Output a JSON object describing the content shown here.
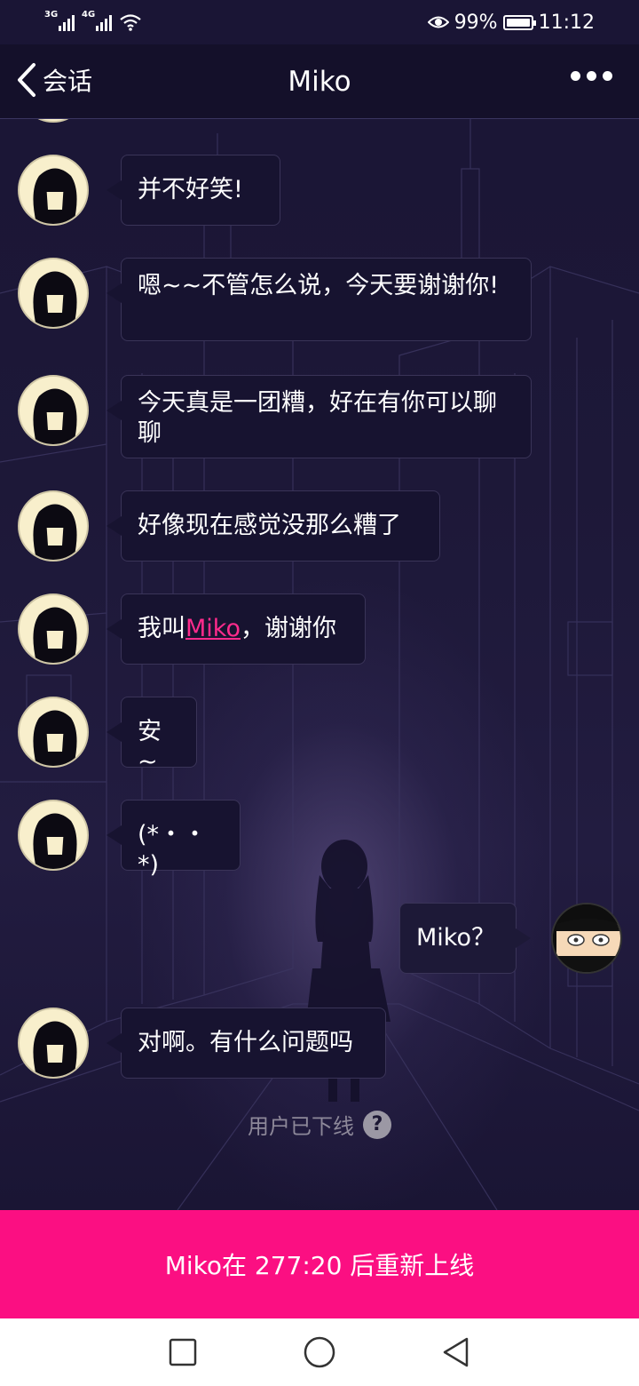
{
  "status_bar": {
    "net1": "3G",
    "net2": "4G",
    "battery": "99%",
    "time": "11:12"
  },
  "header": {
    "back_label": "会话",
    "title": "Miko"
  },
  "messages": [
    {
      "side": "left",
      "text": "并不好笑!"
    },
    {
      "side": "left",
      "text": "嗯~~不管怎么说，今天要谢谢你!"
    },
    {
      "side": "left",
      "text": "今天真是一团糟，好在有你可以聊聊"
    },
    {
      "side": "left",
      "text": "好像现在感觉没那么糟了"
    },
    {
      "side": "left",
      "text_before": "我叫",
      "highlight": "Miko",
      "text_after": "，谢谢你"
    },
    {
      "side": "left",
      "text": "安~"
    },
    {
      "side": "left",
      "text": "(*・・*)"
    },
    {
      "side": "right",
      "text": "Miko？"
    },
    {
      "side": "left",
      "text": "对啊。有什么问题吗"
    }
  ],
  "offline_notice": "用户已下线",
  "banner": "Miko在 277:20 后重新上线",
  "colors": {
    "accent": "#fb0f82",
    "highlight": "#ff2b8c",
    "background": "#17122e"
  }
}
